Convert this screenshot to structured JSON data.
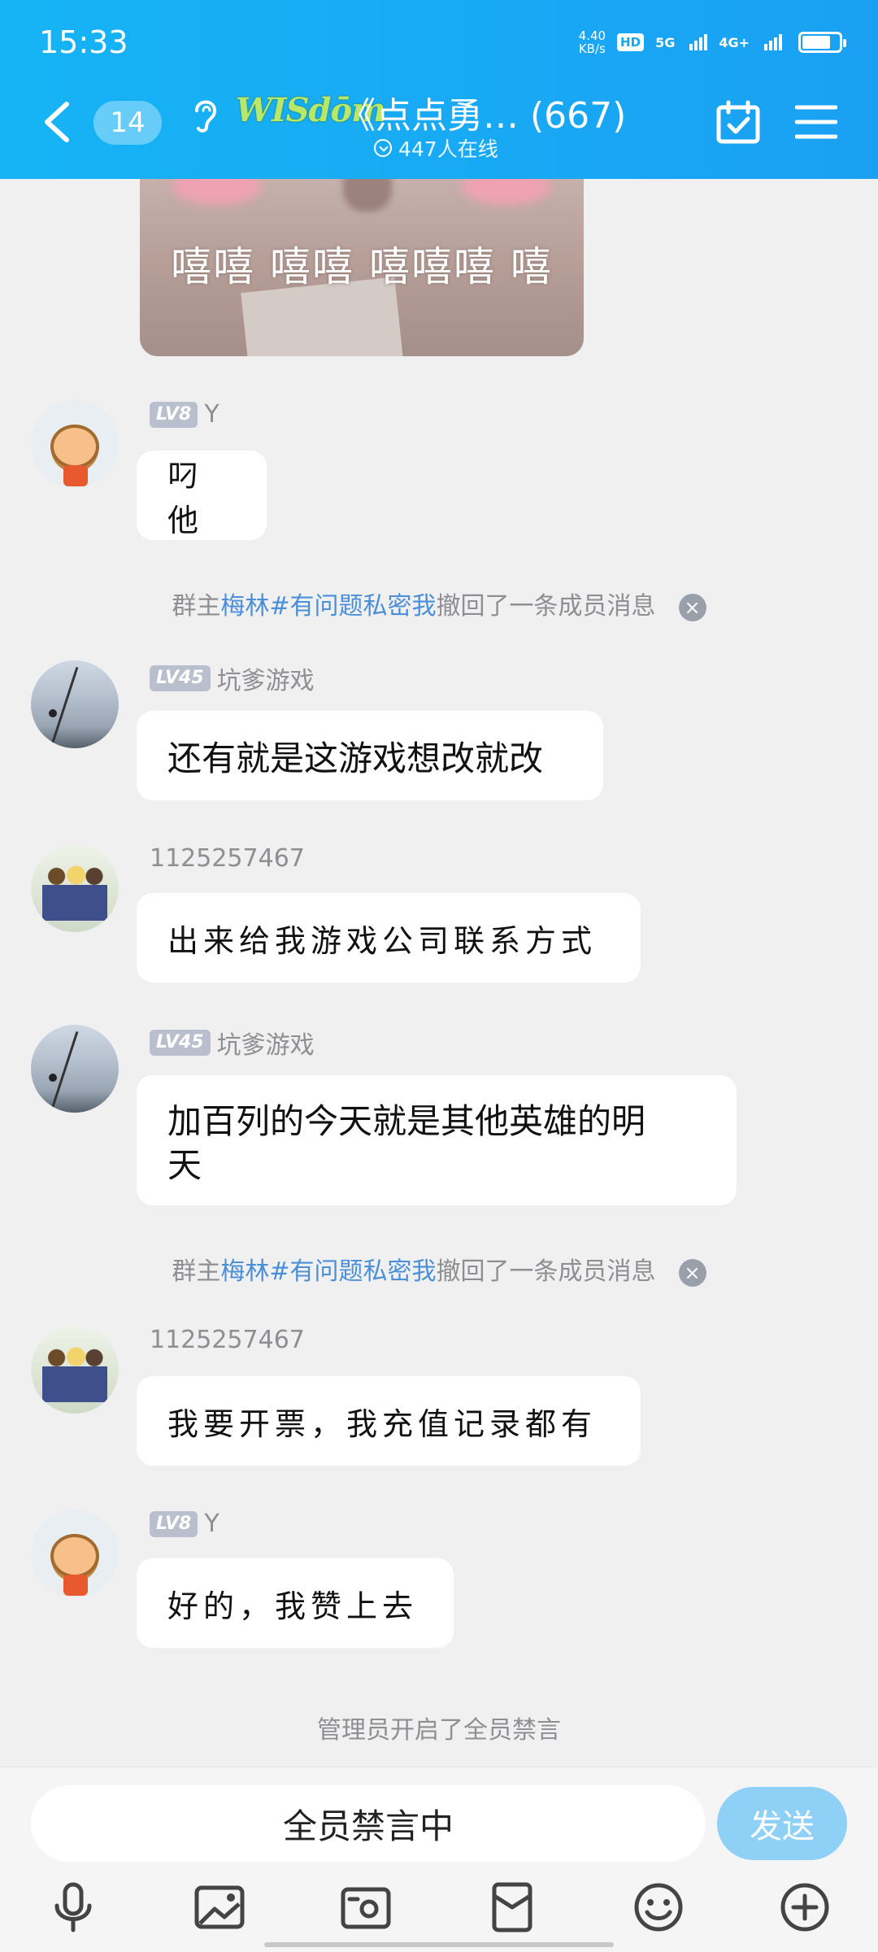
{
  "status_bar": {
    "time": "15:33",
    "speed_value": "4.40",
    "speed_unit": "KB/s",
    "hd_label": "HD",
    "net1": "5G",
    "net2": "4G+"
  },
  "header": {
    "unread_count": "14",
    "logo_text": "WISdōm",
    "title": "《点点勇…  (667)",
    "online_text": "447人在线"
  },
  "sticker": {
    "caption": "嘻嘻 嘻嘻  嘻嘻嘻 嘻"
  },
  "messages": [
    {
      "level": "LV8",
      "name": "Y",
      "text": "叼他"
    },
    {
      "system_prefix": "群主",
      "system_name": "梅林#有问题私密我",
      "system_suffix": "撤回了一条成员消息",
      "close_icon": "×"
    },
    {
      "level": "LV45",
      "name": "坑爹游戏",
      "text": "还有就是这游戏想改就改"
    },
    {
      "name": "1125257467",
      "text": "出来给我游戏公司联系方式"
    },
    {
      "level": "LV45",
      "name": "坑爹游戏",
      "text_line1": "加百列的今天就是其他英雄的明",
      "text_line2": "天"
    },
    {
      "system_prefix": "群主",
      "system_name": "梅林#有问题私密我",
      "system_suffix": "撤回了一条成员消息",
      "close_icon": "×"
    },
    {
      "name": "1125257467",
      "text": "我要开票，我充值记录都有"
    },
    {
      "level": "LV8",
      "name": "Y",
      "text": "好的，我赞上去"
    },
    {
      "system_text": "管理员开启了全员禁言"
    }
  ],
  "input": {
    "value": "全员禁言中",
    "send_label": "发送"
  },
  "toolbar_icons": [
    "microphone-icon",
    "image-icon",
    "camera-icon",
    "red-packet-icon",
    "emoji-icon",
    "plus-icon"
  ],
  "colors": {
    "header": "#16b4f5",
    "link": "#4a8fd8",
    "send": "#8fd0f6"
  }
}
